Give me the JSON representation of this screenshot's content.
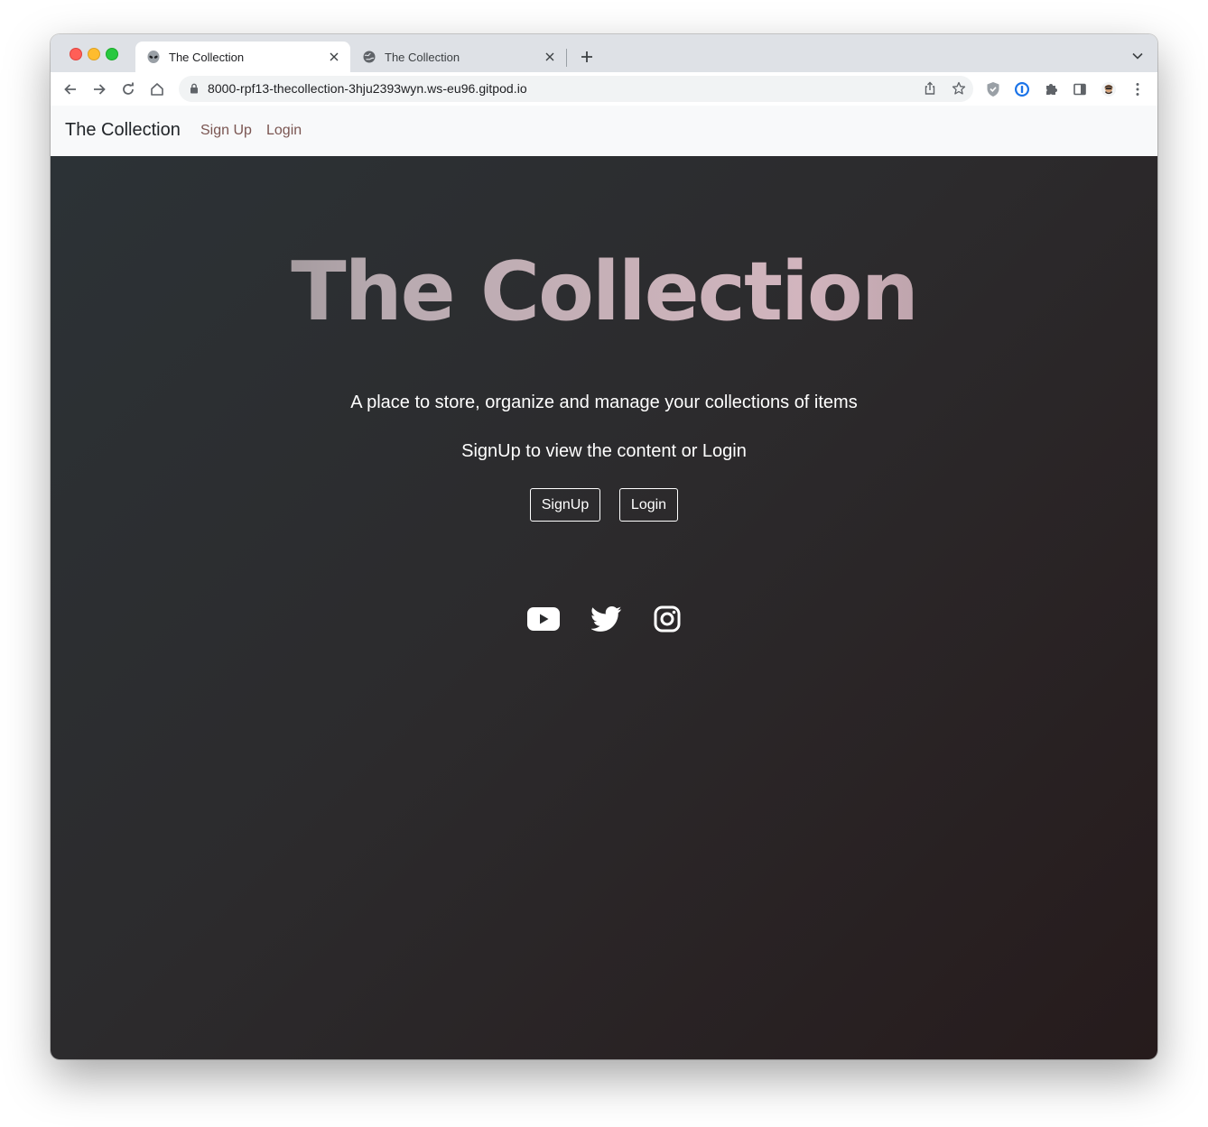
{
  "browser": {
    "tabs": [
      {
        "title": "The Collection",
        "active": true,
        "favicon": "alien-icon"
      },
      {
        "title": "The Collection",
        "active": false,
        "favicon": "globe-icon"
      }
    ],
    "url": "8000-rpf13-thecollection-3hju2393wyn.ws-eu96.gitpod.io"
  },
  "navbar": {
    "brand": "The Collection",
    "links": [
      "Sign Up",
      "Login"
    ]
  },
  "hero": {
    "title": "The Collection",
    "tagline": "A place to store, organize and manage your collections of items",
    "prompt": "SignUp to view the content or Login",
    "buttons": [
      "SignUp",
      "Login"
    ],
    "social": [
      "youtube-icon",
      "twitter-icon",
      "instagram-icon"
    ]
  },
  "colors": {
    "navbar_bg": "#f8f9fa",
    "nav_link": "#7a5551",
    "hero_bg_start": "#2c3236",
    "hero_bg_end": "#261b1c"
  }
}
